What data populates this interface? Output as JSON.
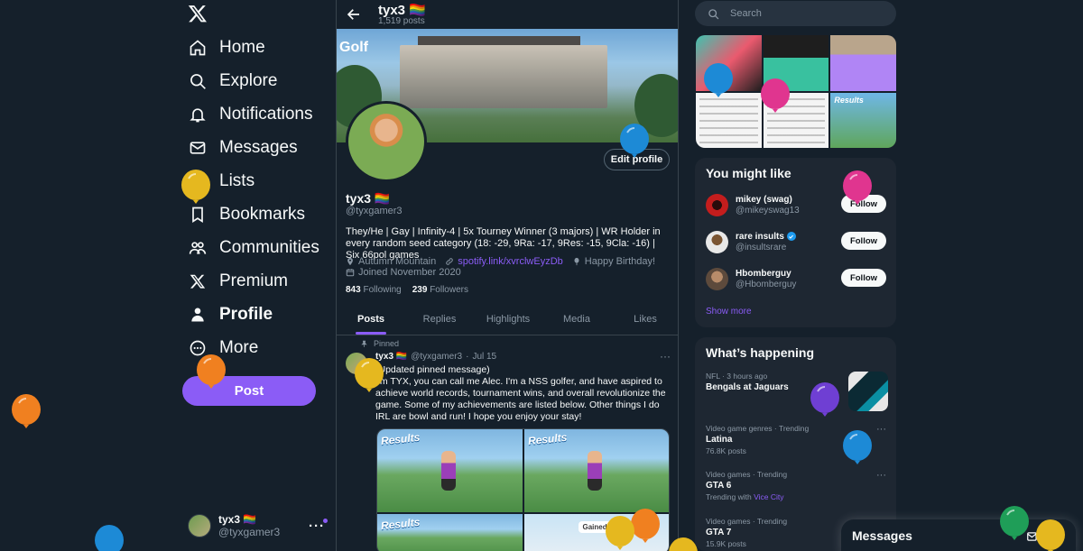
{
  "nav": {
    "items": [
      {
        "key": "home",
        "label": "Home",
        "icon": "home-icon"
      },
      {
        "key": "explore",
        "label": "Explore",
        "icon": "search-icon"
      },
      {
        "key": "notifications",
        "label": "Notifications",
        "icon": "bell-icon"
      },
      {
        "key": "messages",
        "label": "Messages",
        "icon": "envelope-icon"
      },
      {
        "key": "lists",
        "label": "Lists",
        "icon": "list-icon"
      },
      {
        "key": "bookmarks",
        "label": "Bookmarks",
        "icon": "bookmark-icon"
      },
      {
        "key": "communities",
        "label": "Communities",
        "icon": "people-icon"
      },
      {
        "key": "premium",
        "label": "Premium",
        "icon": "x-logo-icon"
      },
      {
        "key": "profile",
        "label": "Profile",
        "icon": "person-icon"
      },
      {
        "key": "more",
        "label": "More",
        "icon": "more-circle-icon"
      }
    ],
    "post_label": "Post",
    "account": {
      "name": "tyx3 🏳️‍🌈",
      "handle": "@tyxgamer3",
      "more": "···"
    }
  },
  "profile": {
    "top_name": "tyx3 🏳️‍🌈",
    "top_posts": "1,519 posts",
    "banner_label": "Golf",
    "edit_label": "Edit profile",
    "display_name": "tyx3 🏳️‍🌈",
    "handle": "@tyxgamer3",
    "bio": "They/He | Gay | Infinity-4 | 5x Tourney Winner (3 majors) | WR Holder in every random seed category (18: -29, 9Ra: -17, 9Res: -15, 9Cla: -16) | Six 66pol games",
    "location": "Autumn Mountain",
    "link": "spotify.link/xvrclwEyzDb",
    "birthday": "Happy Birthday!",
    "joined": "Joined November 2020",
    "following_count": "843",
    "following_label": "Following",
    "followers_count": "239",
    "followers_label": "Followers"
  },
  "tabs": [
    "Posts",
    "Replies",
    "Highlights",
    "Media",
    "Likes"
  ],
  "tweet": {
    "pinned_label": "Pinned",
    "name": "tyx3 🏳️‍🌈",
    "handle": "@tyxgamer3",
    "sep": "·",
    "date": "Jul 15",
    "more": "···",
    "text": "(Updated pinned message)\nI'm TYX, you can call me Alec. I'm a NSS golfer, and have aspired to achieve world records, tournament wins, and overall revolutionize the game. Some of my achievements are listed below. Other things I do IRL are bowl and run! I hope you enjoy your stay!",
    "media_label": "Results",
    "gained_label": "Gained rank!"
  },
  "search": {
    "placeholder": "Search"
  },
  "might_like": {
    "title": "You might like",
    "users": [
      {
        "name": "mikey (swag)",
        "handle": "@mikeyswag13",
        "verified": false,
        "follow": "Follow"
      },
      {
        "name": "rare insults",
        "handle": "@insultsrare",
        "verified": true,
        "follow": "Follow"
      },
      {
        "name": "Hbomberguy",
        "handle": "@Hbomberguy",
        "verified": false,
        "follow": "Follow"
      }
    ],
    "show_more": "Show more"
  },
  "happening": {
    "title": "What’s happening",
    "trends": [
      {
        "context": "NFL · 3 hours ago",
        "title": "Bengals at Jaguars",
        "sub": ""
      },
      {
        "context": "Video game genres · Trending",
        "title": "Latina",
        "sub": "76.8K posts"
      },
      {
        "context": "Video games · Trending",
        "title": "GTA 6",
        "sub_prefix": "Trending with",
        "sub_link": "Vice City"
      },
      {
        "context": "Video games · Trending",
        "title": "GTA 7",
        "sub": "15.9K posts"
      }
    ],
    "more": "···"
  },
  "messages_drawer": {
    "title": "Messages"
  },
  "colors": {
    "background": "#15202b",
    "accent": "#8b5cf6",
    "muted": "#8b98a5",
    "card": "#1e2732"
  }
}
